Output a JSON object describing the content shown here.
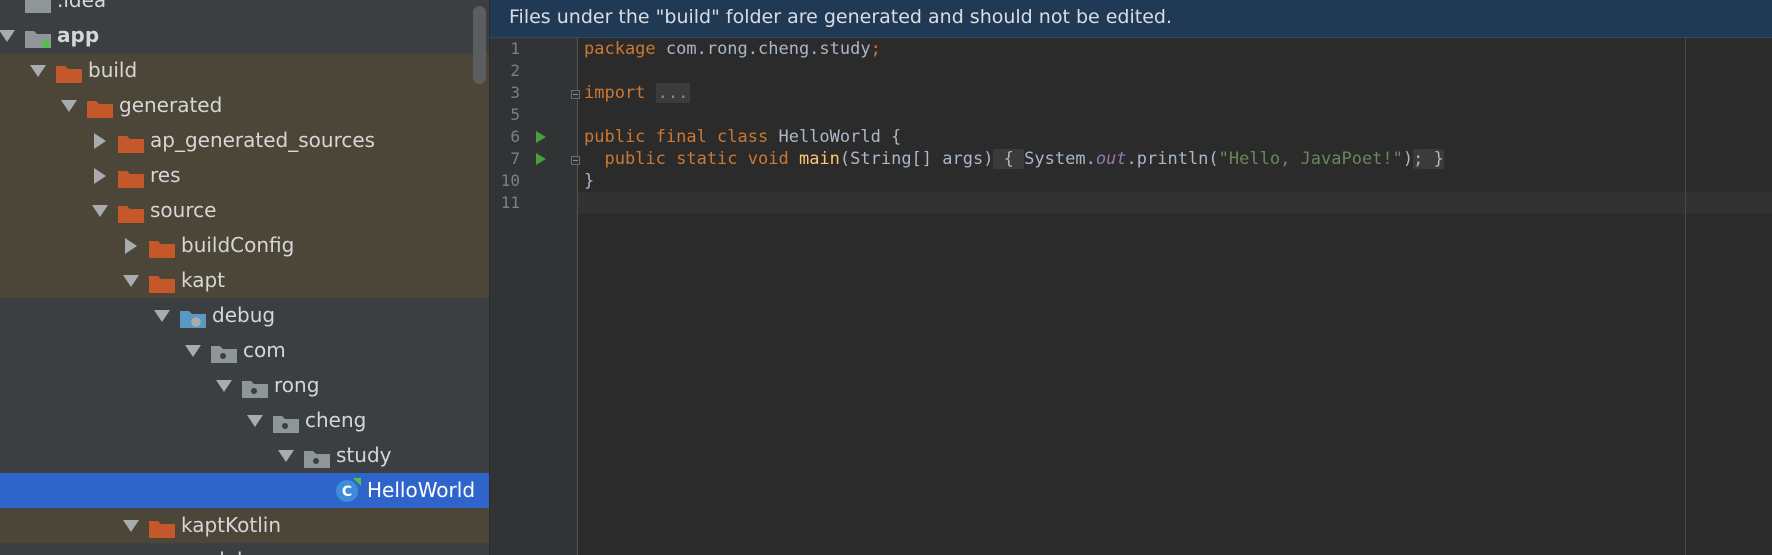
{
  "tree": {
    "items": [
      {
        "label": ".idea",
        "depth": 0,
        "arrow": "none",
        "icon": "folder-grey",
        "style": "normal"
      },
      {
        "label": "app",
        "depth": 0,
        "arrow": "down",
        "icon": "module",
        "style": "normal",
        "bold": true
      },
      {
        "label": "build",
        "depth": 1,
        "arrow": "down",
        "icon": "folder-orange",
        "style": "excl"
      },
      {
        "label": "generated",
        "depth": 2,
        "arrow": "down",
        "icon": "folder-orange",
        "style": "excl"
      },
      {
        "label": "ap_generated_sources",
        "depth": 3,
        "arrow": "right",
        "icon": "folder-orange",
        "style": "excl"
      },
      {
        "label": "res",
        "depth": 3,
        "arrow": "right",
        "icon": "folder-orange",
        "style": "excl"
      },
      {
        "label": "source",
        "depth": 3,
        "arrow": "down",
        "icon": "folder-orange",
        "style": "excl"
      },
      {
        "label": "buildConfig",
        "depth": 4,
        "arrow": "right",
        "icon": "folder-orange",
        "style": "excl"
      },
      {
        "label": "kapt",
        "depth": 4,
        "arrow": "down",
        "icon": "folder-orange",
        "style": "excl"
      },
      {
        "label": "debug",
        "depth": 5,
        "arrow": "down",
        "icon": "source-root",
        "style": "normal"
      },
      {
        "label": "com",
        "depth": 6,
        "arrow": "down",
        "icon": "package",
        "style": "normal"
      },
      {
        "label": "rong",
        "depth": 7,
        "arrow": "down",
        "icon": "package",
        "style": "normal"
      },
      {
        "label": "cheng",
        "depth": 8,
        "arrow": "down",
        "icon": "package",
        "style": "normal"
      },
      {
        "label": "study",
        "depth": 9,
        "arrow": "down",
        "icon": "package",
        "style": "normal"
      },
      {
        "label": "HelloWorld",
        "depth": 10,
        "arrow": "none",
        "icon": "java-class",
        "style": "sel"
      },
      {
        "label": "kaptKotlin",
        "depth": 4,
        "arrow": "down",
        "icon": "folder-orange",
        "style": "excl"
      },
      {
        "label": "deb",
        "depth": 5,
        "arrow": "none",
        "icon": "source-root",
        "style": "normal"
      }
    ]
  },
  "editor": {
    "banner": "Files under the \"build\" folder are generated and should not be edited.",
    "line_numbers": [
      "1",
      "2",
      "3",
      "5",
      "6",
      "7",
      "10",
      "11"
    ],
    "code": {
      "l1_kw": "package",
      "l1_pkg": " com.rong.cheng.study",
      "l1_semi": ";",
      "l3_kw": "import",
      "l3_dots": "...",
      "l6_kw": "public final class",
      "l6_rest": " HelloWorld {",
      "l7_kw": "  public static void",
      "l7_fn": "main",
      "l7_params": "(String[] args)",
      "l7_open": " { ",
      "l7_sys": "System.",
      "l7_field": "out",
      "l7_call": ".println(",
      "l7_str": "\"Hello, JavaPoet!\"",
      "l7_close": ")",
      "l7_semi": ";",
      "l7_brace": " }",
      "l10": "}"
    }
  },
  "colors": {
    "keyword": "#cc7832",
    "function": "#ffc66d",
    "string": "#6a8759",
    "field": "#9876aa",
    "selection": "#2f65ca",
    "excluded_bg": "#4b4637",
    "banner_bg": "#203a56"
  }
}
